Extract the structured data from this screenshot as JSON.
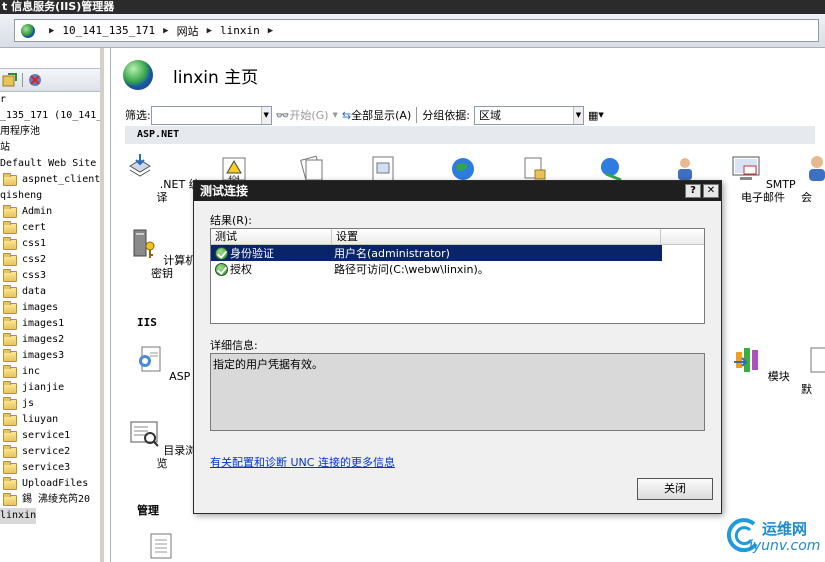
{
  "window": {
    "title": "t 信息服务(IIS)管理器"
  },
  "address": {
    "crumbs": [
      "10_141_135_171",
      "网站",
      "linxin"
    ]
  },
  "tree": {
    "lines": [
      "r",
      "_135_171 (10_141_",
      "用程序池",
      "站",
      "Default Web Site"
    ],
    "folders": [
      "aspnet_client"
    ],
    "site": "qisheng",
    "site_folders": [
      "Admin",
      "cert",
      "css1",
      "css2",
      "css3",
      "data",
      "images",
      "images1",
      "images2",
      "images3",
      "inc",
      "jianjie",
      "js",
      "liuyan",
      "service1",
      "service2",
      "service3",
      "UploadFiles",
      "錫  沸绫充笍20"
    ],
    "selected": "linxin"
  },
  "main": {
    "title": "linxin 主页",
    "filter": {
      "label": "筛选:",
      "go": "开始(G)",
      "show_all": "全部显示(A)",
      "group_by_label": "分组依据:",
      "group_by_value": "区域"
    },
    "sections": {
      "aspnet": "ASP.NET",
      "iis": "IIS",
      "manage": "管理"
    },
    "features": {
      "net_compile": ".NET 编译",
      "machine_key": "计算机密钥",
      "smtp": "SMTP 电子邮件",
      "smtp_cut": "会",
      "asp": "ASP",
      "dir_browse": "目录浏览",
      "modules": "模块",
      "cut_right": "默"
    }
  },
  "dialog": {
    "title": "测试连接",
    "help_btn": "?",
    "close_btn": "✕",
    "results_label": "结果(R):",
    "columns": [
      "测试",
      "设置"
    ],
    "rows": [
      {
        "test": "身份验证",
        "setting": "用户名(administrator)"
      },
      {
        "test": "授权",
        "setting": "路径可访问(C:\\webw\\linxin)。"
      }
    ],
    "details_label": "详细信息:",
    "details_text": "指定的用户凭据有效。",
    "link": "有关配置和诊断 UNC 连接的更多信息",
    "close_button": "关闭"
  },
  "watermark": {
    "name": "运维网",
    "site": "iyunv.com"
  },
  "colors": {
    "selection": "#0a246a",
    "link": "#0033cc",
    "titlebar": "#2b2b2b"
  }
}
